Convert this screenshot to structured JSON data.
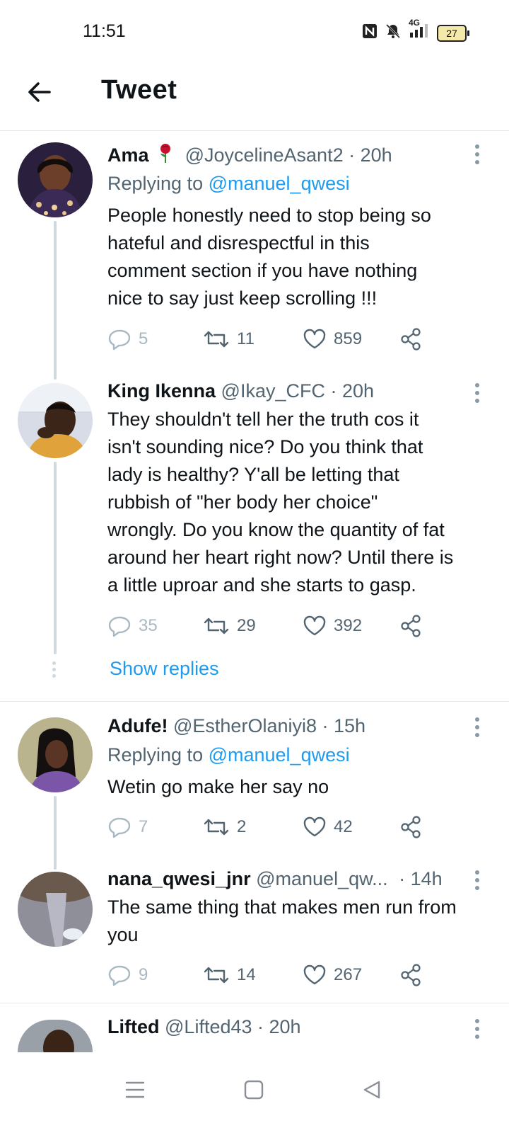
{
  "status_bar": {
    "time": "11:51",
    "network": "4G",
    "battery": "27"
  },
  "header": {
    "title": "Tweet"
  },
  "tweets": [
    {
      "name": "Ama",
      "handle": "@JoycelineAsant2",
      "time": "· 20h",
      "replying_prefix": "Replying to ",
      "replying_handle": "@manuel_qwesi",
      "text": "People honestly need to stop being so\nhateful and disrespectful in this\ncomment section if you have nothing\nnice to say just keep scrolling !!!",
      "replies": "5",
      "retweets": "11",
      "likes": "859"
    },
    {
      "name": "King Ikenna",
      "handle": "@Ikay_CFC",
      "time": "· 20h",
      "text": "They shouldn't tell her the truth cos it\nisn't sounding nice? Do you think that\nlady is healthy? Y'all be letting that\nrubbish of \"her body her choice\"\nwrongly. Do you know the quantity of fat\naround her heart right now? Until there is\na little uproar and she starts to gasp.",
      "replies": "35",
      "retweets": "29",
      "likes": "392"
    },
    {
      "name": "Adufe!",
      "handle": "@EstherOlaniyi8",
      "time": "· 15h",
      "replying_prefix": "Replying to ",
      "replying_handle": "@manuel_qwesi",
      "text": "Wetin go make her say no",
      "replies": "7",
      "retweets": "2",
      "likes": "42"
    },
    {
      "name": "nana_qwesi_jnr",
      "handle": "@manuel_qw...",
      "time": "· 14h",
      "text": "The same thing that makes men run from\nyou",
      "replies": "9",
      "retweets": "14",
      "likes": "267"
    },
    {
      "name": "Lifted",
      "handle": "@Lifted43",
      "time": "· 20h"
    }
  ],
  "show_replies": "Show replies",
  "colors": {
    "accent": "#1d9bf0",
    "muted": "#536471",
    "line": "#cfd9de"
  }
}
